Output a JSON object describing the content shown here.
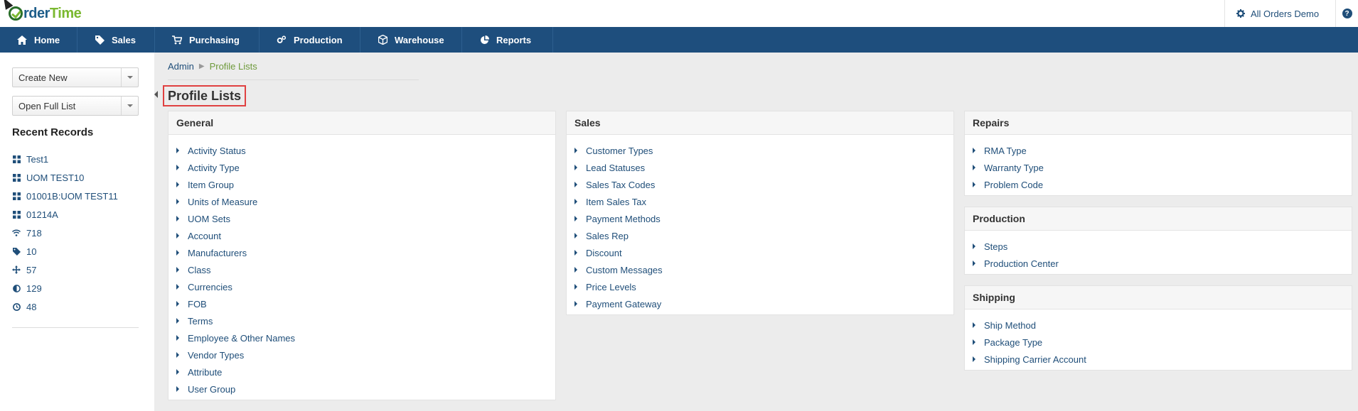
{
  "app": {
    "logo_text_a": "rder",
    "logo_text_b": "Time",
    "company": "All Orders Demo",
    "help_label": "?"
  },
  "nav": [
    {
      "label": "Home",
      "icon": "home-icon"
    },
    {
      "label": "Sales",
      "icon": "tag-icon"
    },
    {
      "label": "Purchasing",
      "icon": "cart-icon"
    },
    {
      "label": "Production",
      "icon": "gears-icon"
    },
    {
      "label": "Warehouse",
      "icon": "cube-icon"
    },
    {
      "label": "Reports",
      "icon": "pie-chart-icon"
    }
  ],
  "sidebar": {
    "create_new": "Create New",
    "open_full_list": "Open Full List",
    "recent_title": "Recent Records",
    "recent": [
      {
        "label": "Test1",
        "icon": "grid-icon"
      },
      {
        "label": "UOM TEST10",
        "icon": "grid-icon"
      },
      {
        "label": "01001B:UOM TEST11",
        "icon": "grid-icon"
      },
      {
        "label": "01214A",
        "icon": "grid-icon"
      },
      {
        "label": "718",
        "icon": "wifi-icon"
      },
      {
        "label": "10",
        "icon": "tag-icon"
      },
      {
        "label": "57",
        "icon": "move-icon"
      },
      {
        "label": "129",
        "icon": "half-circle-icon"
      },
      {
        "label": "48",
        "icon": "clock-icon"
      }
    ]
  },
  "breadcrumb": {
    "parent": "Admin",
    "current": "Profile Lists"
  },
  "page_title": "Profile Lists",
  "panels": {
    "general": {
      "title": "General",
      "items": [
        "Activity Status",
        "Activity Type",
        "Item Group",
        "Units of Measure",
        "UOM Sets",
        "Account",
        "Manufacturers",
        "Class",
        "Currencies",
        "FOB",
        "Terms",
        "Employee & Other Names",
        "Vendor Types",
        "Attribute",
        "User Group"
      ]
    },
    "sales": {
      "title": "Sales",
      "items": [
        "Customer Types",
        "Lead Statuses",
        "Sales Tax Codes",
        "Item Sales Tax",
        "Payment Methods",
        "Sales Rep",
        "Discount",
        "Custom Messages",
        "Price Levels",
        "Payment Gateway"
      ]
    },
    "repairs": {
      "title": "Repairs",
      "items": [
        "RMA Type",
        "Warranty Type",
        "Problem Code"
      ]
    },
    "production": {
      "title": "Production",
      "items": [
        "Steps",
        "Production Center"
      ]
    },
    "shipping": {
      "title": "Shipping",
      "items": [
        "Ship Method",
        "Package Type",
        "Shipping Carrier Account"
      ]
    }
  },
  "colors": {
    "nav_bg": "#1e4e7d",
    "link": "#1f4e79",
    "breadcrumb_current": "#6e9a3b",
    "highlight_border": "#e04141",
    "brand_green": "#7ab830"
  }
}
